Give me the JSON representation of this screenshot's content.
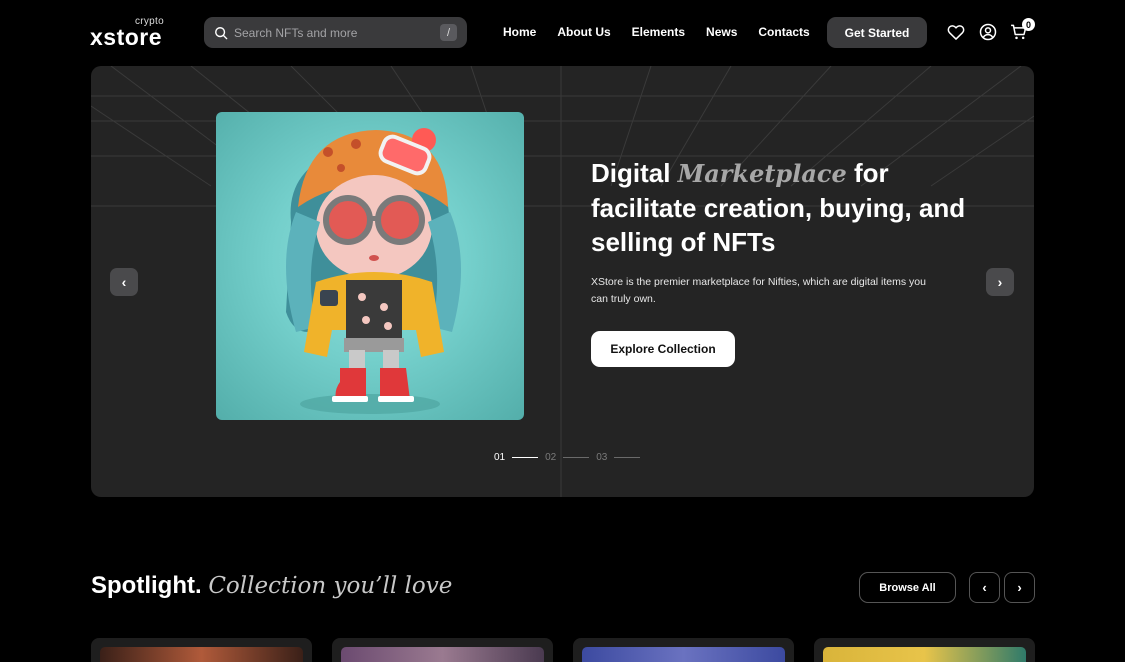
{
  "brand": {
    "small": "crypto",
    "name": "xstore"
  },
  "search": {
    "placeholder": "Search NFTs and more",
    "shortcut": "/"
  },
  "nav": [
    "Home",
    "About Us",
    "Elements",
    "News",
    "Contacts"
  ],
  "header": {
    "cta_label": "Get Started",
    "cart_count": "0"
  },
  "hero": {
    "title_start": "Digital ",
    "title_em": "Marketplace",
    "title_end": " for facilitate creation, buying, and selling of NFTs",
    "description": "XStore is the premier marketplace for Nifties, which are digital items you can truly own.",
    "cta_label": "Explore Collection",
    "pages": [
      "01",
      "02",
      "03"
    ],
    "active_page": "01"
  },
  "spotlight": {
    "title": "Spotlight.",
    "subtitle": "Collection you’ll love",
    "browse_label": "Browse All"
  },
  "colors": {
    "background": "#000000",
    "hero_bg": "#242424",
    "button_dark": "#3a3a3c",
    "art_bg": "#74cfcb"
  },
  "cards": [
    {
      "theme": "#3a2018"
    },
    {
      "theme": "#6b4a70"
    },
    {
      "theme": "#3c4aa0"
    },
    {
      "theme": "#d9b43a"
    }
  ]
}
